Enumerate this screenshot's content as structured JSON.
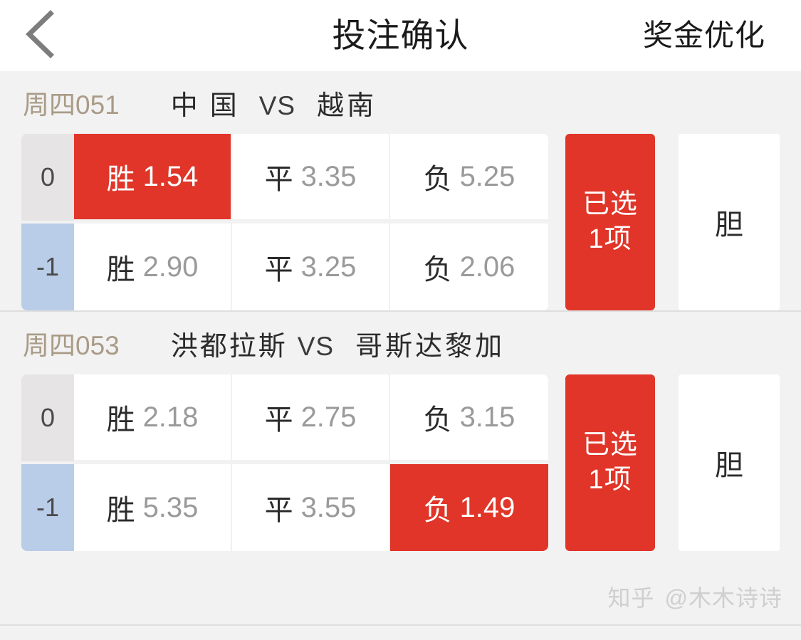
{
  "header": {
    "back_icon": "chevron-left-icon",
    "title": "投注确认",
    "action_label": "奖金优化"
  },
  "matches": [
    {
      "match_no": "周四051",
      "home_team": "中国",
      "vs": "VS",
      "away_team": "越南",
      "rows": [
        {
          "handicap": "0",
          "options": [
            {
              "label": "胜",
              "odds": "1.54",
              "selected": true
            },
            {
              "label": "平",
              "odds": "3.35",
              "selected": false
            },
            {
              "label": "负",
              "odds": "5.25",
              "selected": false
            }
          ]
        },
        {
          "handicap": "-1",
          "options": [
            {
              "label": "胜",
              "odds": "2.90",
              "selected": false
            },
            {
              "label": "平",
              "odds": "3.25",
              "selected": false
            },
            {
              "label": "负",
              "odds": "2.06",
              "selected": false
            }
          ]
        }
      ],
      "selected_panel": {
        "line1": "已选",
        "line2": "1项"
      },
      "dan_label": "胆"
    },
    {
      "match_no": "周四053",
      "home_team": "洪都拉斯",
      "vs": "VS",
      "away_team": "哥斯达黎加",
      "rows": [
        {
          "handicap": "0",
          "options": [
            {
              "label": "胜",
              "odds": "2.18",
              "selected": false
            },
            {
              "label": "平",
              "odds": "2.75",
              "selected": false
            },
            {
              "label": "负",
              "odds": "3.15",
              "selected": false
            }
          ]
        },
        {
          "handicap": "-1",
          "options": [
            {
              "label": "胜",
              "odds": "5.35",
              "selected": false
            },
            {
              "label": "平",
              "odds": "3.55",
              "selected": false
            },
            {
              "label": "负",
              "odds": "1.49",
              "selected": true
            }
          ]
        }
      ],
      "selected_panel": {
        "line1": "已选",
        "line2": "1项"
      },
      "dan_label": "胆"
    }
  ],
  "watermark": {
    "site": "知乎",
    "user": "@木木诗诗"
  },
  "colors": {
    "selected_red": "#e03528",
    "page_bg": "#f2f2f2",
    "handicap_zero_bg": "#e6e4e4",
    "handicap_minus_bg": "#b9cce8",
    "match_no_text": "#a99b87"
  }
}
